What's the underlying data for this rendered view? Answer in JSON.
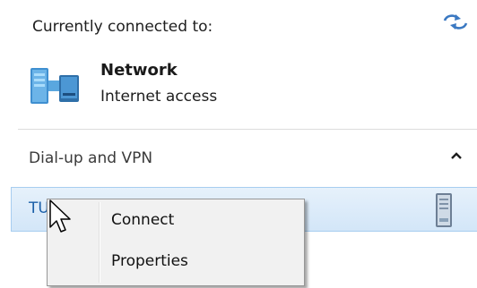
{
  "connection": {
    "header": "Currently connected to:",
    "network_name": "Network",
    "network_status": "Internet access"
  },
  "section": {
    "title": "Dial-up and VPN",
    "vpn_item_label": "TU"
  },
  "context_menu": {
    "items": [
      {
        "label": "Connect"
      },
      {
        "label": "Properties"
      }
    ]
  },
  "icons": {
    "refresh": "refresh-icon",
    "network": "network-icon",
    "chevron": "chevron-up-icon",
    "vpn": "vpn-connection-icon",
    "cursor": "mouse-cursor-icon"
  },
  "colors": {
    "selection_bg": "#d9eaf9",
    "selection_border": "#a7cdf0",
    "link_text": "#1a5fa8",
    "menu_bg": "#f1f1f1"
  }
}
